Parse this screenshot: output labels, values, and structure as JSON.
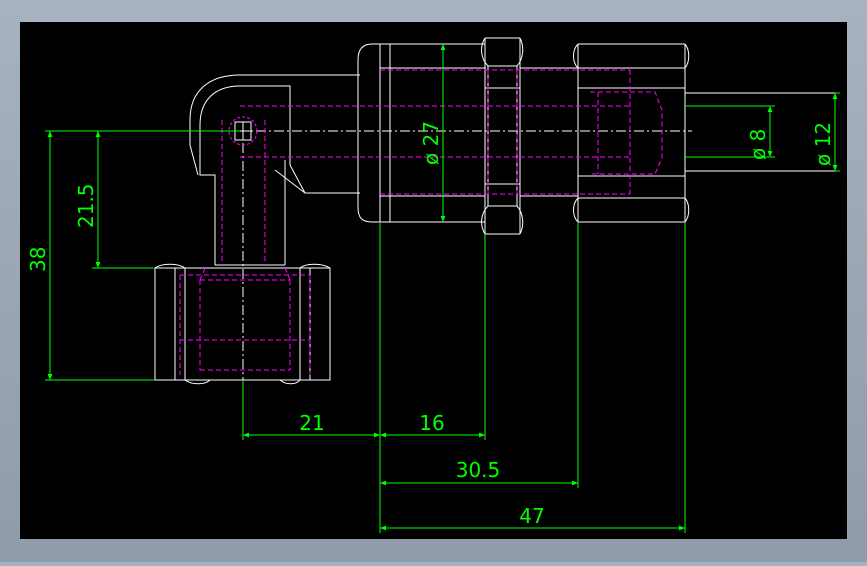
{
  "colors": {
    "background_frame": "#97a3b2",
    "canvas": "#000000",
    "outline": "#ffffff",
    "hidden_line": "#ff00ff",
    "dimension": "#00ff00",
    "center_line": "#ffffff"
  },
  "dimensions": {
    "d_8": "ø 8",
    "d_12": "ø 12",
    "d_27": "ø 27",
    "v_38": "38",
    "v_21_5": "21.5",
    "h_21": "21",
    "h_16": "16",
    "h_30_5": "30.5",
    "h_47": "47"
  }
}
